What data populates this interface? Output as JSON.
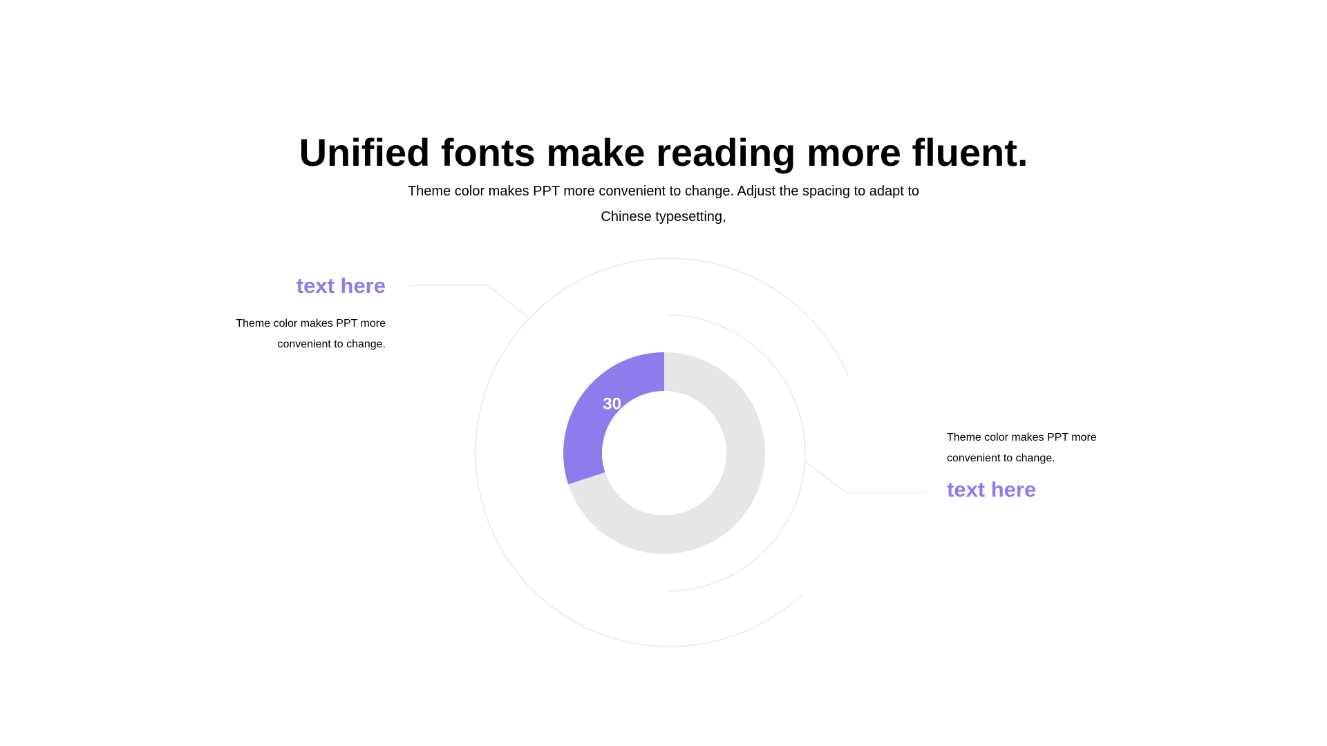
{
  "title": "Unified fonts make reading more fluent.",
  "subtitle": "Theme color makes PPT more convenient to change. Adjust the spacing to adapt to Chinese typesetting,",
  "callouts": {
    "left": {
      "heading": "text here",
      "body": "Theme color makes PPT more convenient to change."
    },
    "right": {
      "heading": "text here",
      "body": "Theme color makes PPT more convenient to change."
    }
  },
  "colors": {
    "accent": "#8E7CEC",
    "track": "#E6E6E6",
    "decor_line": "#E8E8E8",
    "text": "#000000",
    "label_on_accent": "#FFFFFF"
  },
  "chart_data": {
    "type": "pie",
    "style": "donut",
    "total": 100,
    "value": 30,
    "value_label": "30",
    "grid": false,
    "legend": "none"
  }
}
